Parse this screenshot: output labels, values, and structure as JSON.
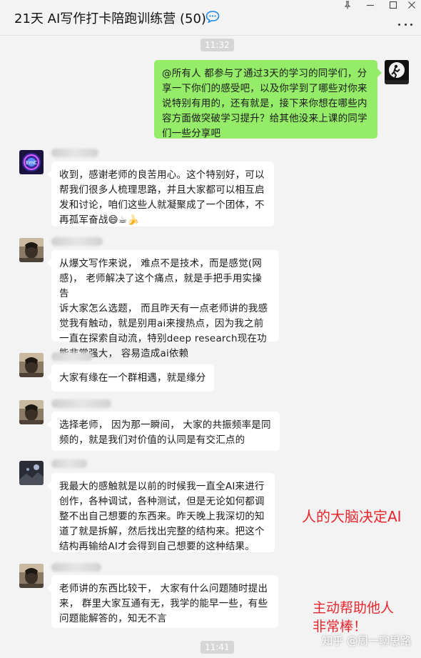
{
  "header": {
    "title": "21天 AI写作打卡陪跑训练营 (50)",
    "icons": [
      "chat-bubble-icon",
      "pin-icon",
      "minimize-icon",
      "maximize-icon",
      "close-icon",
      "more-icon"
    ]
  },
  "timestamps": [
    "11:32",
    "11:41"
  ],
  "messages": [
    {
      "side": "out",
      "text": "@所有人 都参与了通过3天的学习的同学们，分\n享一下你们的感受吧，以及你学到了哪些对你来\n说特别有用的，还有就是，接下来你想在哪些内\n容方面做突破学习提升？给其他没来上课的同学\n们一些分享吧"
    },
    {
      "side": "in",
      "text": "收到，感谢老师的良苦用心。这个特别好，可以\n帮我们很多人梳理思路，并且大家都可以相互启\n发和讨论，咱们这些人就凝聚成了一个团体，不\n再孤军奋战😄☕🍌"
    },
    {
      "side": "in",
      "text": "从爆文写作来说，  难点不是技术，而是感觉(网\n感)，  老师解决了这个痛点，就是手把手用实操告\n诉大家怎么选题，  而且昨天有一点老师讲的我感\n觉我有触动，就是别用ai来搜热点，因为我之前\n一直在探索自动流，特别deep research现在功\n能非常强大，  容易造成ai依赖"
    },
    {
      "side": "in",
      "text": "大家有缘在一个群相遇，就是缘分"
    },
    {
      "side": "in",
      "text": "选择老师，  因为那一瞬间，  大家的共振频率是同\n频的，就是我们对价值的认同是有交汇点的"
    },
    {
      "side": "in",
      "text": "我最大的感触就是以前的时候我一直全AI来进行\n创作，各种调试，各种测试，但是无论如何都调\n整不出自己想要的东西来。昨天晚上我深切的知\n道了就是拆解，然后找出完整的结构来。把这个\n结构再输给AI才会得到自己想要的这种结果。"
    },
    {
      "side": "in",
      "text": "老师讲的东西比较干，  大家有什么问题随时提出\n来，  群里大家互通有无，我学的能早一些，有些\n问题能解答的，知无不言"
    }
  ],
  "annotations": {
    "brain": "人的大脑决定AI",
    "help": "主动帮助他人\n非常棒！"
  },
  "watermark": "知乎 @周一聊思路",
  "colors": {
    "background": "#f3f3f3",
    "outgoing_bubble": "#95ec69",
    "incoming_bubble": "#ffffff",
    "annotation": "#e8262d",
    "title_icon": "#1e88e5"
  }
}
